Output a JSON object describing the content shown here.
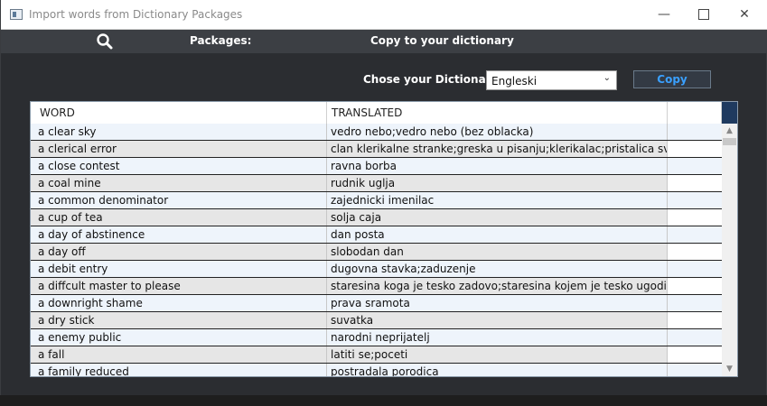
{
  "window": {
    "title": "Import words from Dictionary Packages",
    "minimize_glyph": "—",
    "close_glyph": "✕"
  },
  "nav": {
    "search_icon": "search-icon",
    "packages_label": "Packages:",
    "copy_label": "Copy to your dictionary"
  },
  "dictionary": {
    "chose_label": "Chose your Dictionary:",
    "selected": "Engleski",
    "chevron": "⌄",
    "copy_button": "Copy"
  },
  "table": {
    "headers": {
      "word": "WORD",
      "translated": "TRANSLATED",
      "extra": ""
    },
    "rows": [
      {
        "word": "a clear sky",
        "translated": "vedro nebo;vedro nebo (bez oblacka)"
      },
      {
        "word": "a clerical error",
        "translated": "clan klerikalne stranke;greska u pisanju;klerikalac;pristalica svestenstva"
      },
      {
        "word": "a close contest",
        "translated": "ravna borba"
      },
      {
        "word": "a coal mine",
        "translated": "rudnik uglja"
      },
      {
        "word": "a common denominator",
        "translated": "zajednicki imenilac"
      },
      {
        "word": "a cup of tea",
        "translated": "solja caja"
      },
      {
        "word": "a day of abstinence",
        "translated": "dan posta"
      },
      {
        "word": "a day off",
        "translated": "slobodan dan"
      },
      {
        "word": "a debit entry",
        "translated": "dugovna stavka;zaduzenje"
      },
      {
        "word": "a diffcult master to please",
        "translated": "staresina koga je tesko zadovo;staresina kojem je tesko ugodi"
      },
      {
        "word": "a downright shame",
        "translated": "prava sramota"
      },
      {
        "word": "a dry stick",
        "translated": "suvatka"
      },
      {
        "word": "a enemy public",
        "translated": "narodni neprijatelj"
      },
      {
        "word": "a fall",
        "translated": "latiti se;poceti"
      },
      {
        "word": "a family reduced",
        "translated": "postradala porodica"
      }
    ]
  },
  "scrollbar": {
    "up_glyph": "▲",
    "down_glyph": "▼"
  },
  "colors": {
    "accent": "#3aa0ff",
    "background": "#2b2d31",
    "navbar": "#3c3f44"
  }
}
